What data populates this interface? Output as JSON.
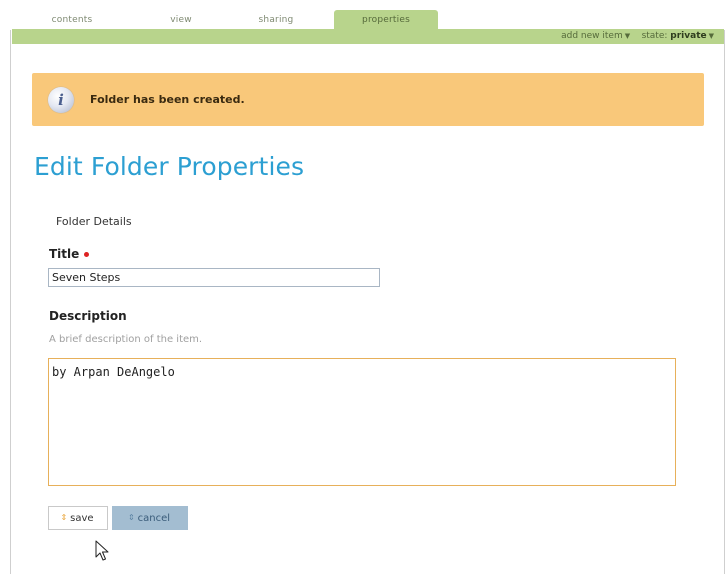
{
  "tabs": [
    {
      "label": "contents",
      "active": false
    },
    {
      "label": "view",
      "active": false
    },
    {
      "label": "sharing",
      "active": false
    },
    {
      "label": "properties",
      "active": true
    }
  ],
  "actionbar": {
    "add_new": "add new item",
    "state_label": "state:",
    "state_value": "private",
    "bar_color": "#b8d48c"
  },
  "message": {
    "icon": "info-icon",
    "text": "Folder has been created.",
    "color": "#f9c87a"
  },
  "page": {
    "title": "Edit Folder Properties",
    "title_color": "#2c9fd2"
  },
  "form": {
    "legend": "Folder Details",
    "title_label": "Title",
    "title_value": "Seven Steps",
    "description_label": "Description",
    "description_help": "A brief description of the item.",
    "description_value": "by Arpan DeAngelo",
    "save_label": "save",
    "cancel_label": "cancel"
  }
}
